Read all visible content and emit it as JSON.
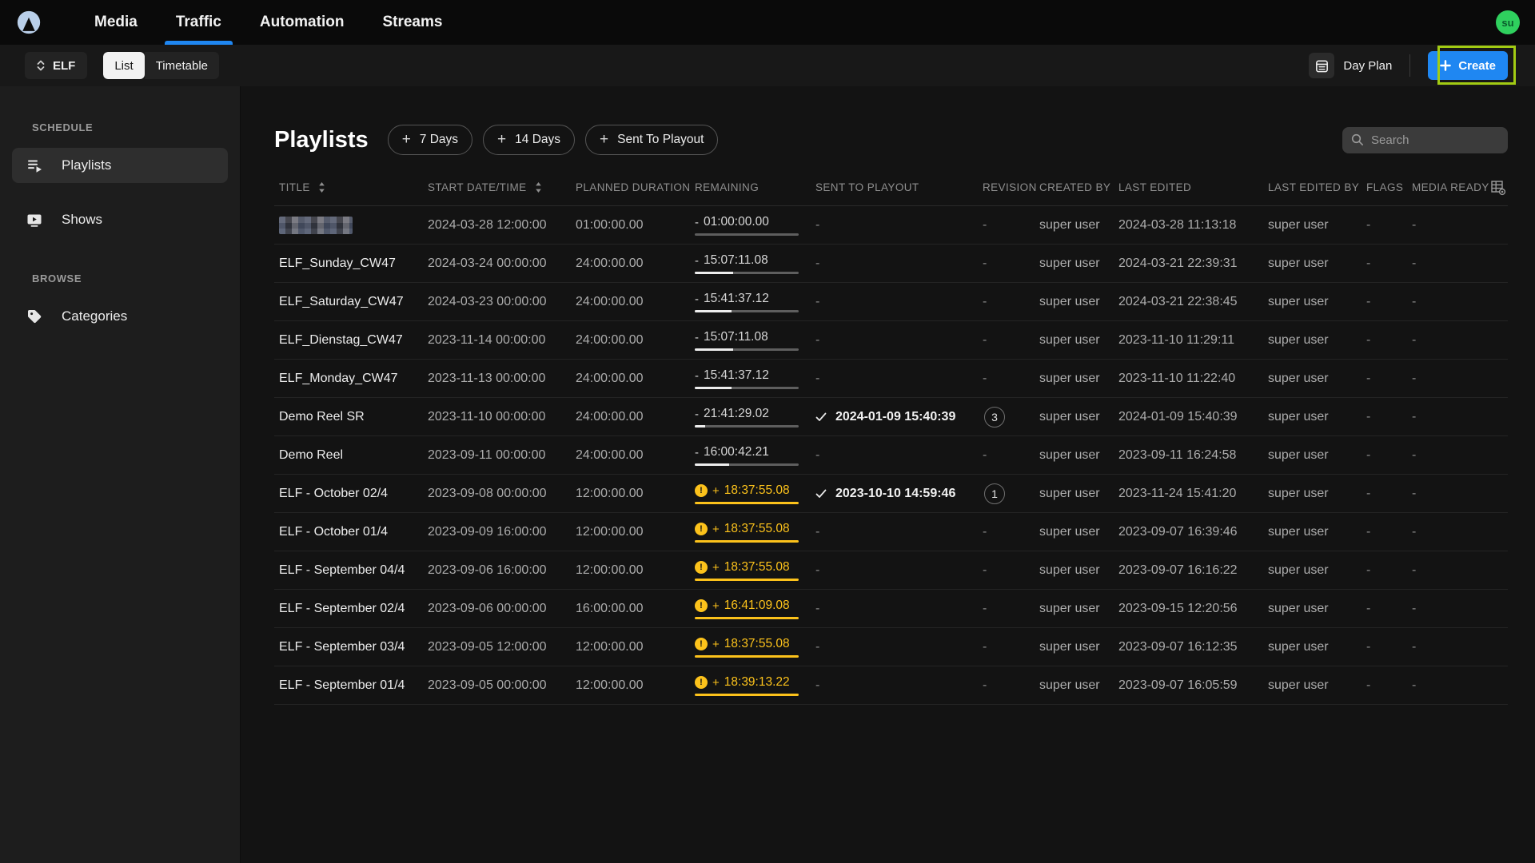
{
  "nav": {
    "items": [
      {
        "label": "Media",
        "active": false
      },
      {
        "label": "Traffic",
        "active": true
      },
      {
        "label": "Automation",
        "active": false
      },
      {
        "label": "Streams",
        "active": false
      }
    ],
    "avatar_initials": "su"
  },
  "toolbar": {
    "channel_selector_label": "ELF",
    "view_toggle": {
      "options": [
        "List",
        "Timetable"
      ],
      "active": "List"
    },
    "day_plan_label": "Day Plan",
    "create_label": "Create"
  },
  "sidebar": {
    "sections": [
      {
        "title": "SCHEDULE",
        "items": [
          {
            "label": "Playlists",
            "icon": "playlist-icon",
            "active": true
          },
          {
            "label": "Shows",
            "icon": "shows-icon",
            "active": false
          }
        ]
      },
      {
        "title": "BROWSE",
        "items": [
          {
            "label": "Categories",
            "icon": "categories-icon",
            "active": false
          }
        ]
      }
    ]
  },
  "content": {
    "title": "Playlists",
    "filter_chips": [
      {
        "label": "7 Days"
      },
      {
        "label": "14 Days"
      },
      {
        "label": "Sent To Playout"
      }
    ],
    "search_placeholder": "Search"
  },
  "table": {
    "columns": [
      {
        "label": "TITLE",
        "sortable": true
      },
      {
        "label": "START DATE/TIME",
        "sortable": true
      },
      {
        "label": "PLANNED DURATION",
        "sortable": false
      },
      {
        "label": "REMAINING",
        "sortable": false
      },
      {
        "label": "SENT TO PLAYOUT",
        "sortable": false
      },
      {
        "label": "REVISION",
        "sortable": false
      },
      {
        "label": "CREATED BY",
        "sortable": false
      },
      {
        "label": "LAST EDITED",
        "sortable": false
      },
      {
        "label": "LAST EDITED BY",
        "sortable": false
      },
      {
        "label": "FLAGS",
        "sortable": false
      },
      {
        "label": "MEDIA READY",
        "sortable": false
      }
    ],
    "rows": [
      {
        "title": "",
        "censored": true,
        "start": "2024-03-28 12:00:00",
        "duration": "01:00:00.00",
        "remaining": {
          "sign": "-",
          "value": "01:00:00.00",
          "state": "normal",
          "progress": 0
        },
        "sent": null,
        "revision": null,
        "created_by": "super user",
        "last_edited": "2024-03-28 11:13:18",
        "last_edited_by": "super user",
        "flags": "-",
        "media_ready": "-"
      },
      {
        "title": "ELF_Sunday_CW47",
        "censored": false,
        "start": "2024-03-24 00:00:00",
        "duration": "24:00:00.00",
        "remaining": {
          "sign": "-",
          "value": "15:07:11.08",
          "state": "normal",
          "progress": 0.37
        },
        "sent": null,
        "revision": null,
        "created_by": "super user",
        "last_edited": "2024-03-21 22:39:31",
        "last_edited_by": "super user",
        "flags": "-",
        "media_ready": "-"
      },
      {
        "title": "ELF_Saturday_CW47",
        "censored": false,
        "start": "2024-03-23 00:00:00",
        "duration": "24:00:00.00",
        "remaining": {
          "sign": "-",
          "value": "15:41:37.12",
          "state": "normal",
          "progress": 0.35
        },
        "sent": null,
        "revision": null,
        "created_by": "super user",
        "last_edited": "2024-03-21 22:38:45",
        "last_edited_by": "super user",
        "flags": "-",
        "media_ready": "-"
      },
      {
        "title": "ELF_Dienstag_CW47",
        "censored": false,
        "start": "2023-11-14 00:00:00",
        "duration": "24:00:00.00",
        "remaining": {
          "sign": "-",
          "value": "15:07:11.08",
          "state": "normal",
          "progress": 0.37
        },
        "sent": null,
        "revision": null,
        "created_by": "super user",
        "last_edited": "2023-11-10 11:29:11",
        "last_edited_by": "super user",
        "flags": "-",
        "media_ready": "-"
      },
      {
        "title": "ELF_Monday_CW47",
        "censored": false,
        "start": "2023-11-13 00:00:00",
        "duration": "24:00:00.00",
        "remaining": {
          "sign": "-",
          "value": "15:41:37.12",
          "state": "normal",
          "progress": 0.35
        },
        "sent": null,
        "revision": null,
        "created_by": "super user",
        "last_edited": "2023-11-10 11:22:40",
        "last_edited_by": "super user",
        "flags": "-",
        "media_ready": "-"
      },
      {
        "title": "Demo Reel SR",
        "censored": false,
        "start": "2023-11-10 00:00:00",
        "duration": "24:00:00.00",
        "remaining": {
          "sign": "-",
          "value": "21:41:29.02",
          "state": "normal",
          "progress": 0.1
        },
        "sent": "2024-01-09 15:40:39",
        "revision": "3",
        "created_by": "super user",
        "last_edited": "2024-01-09 15:40:39",
        "last_edited_by": "super user",
        "flags": "-",
        "media_ready": "-"
      },
      {
        "title": "Demo Reel",
        "censored": false,
        "start": "2023-09-11 00:00:00",
        "duration": "24:00:00.00",
        "remaining": {
          "sign": "-",
          "value": "16:00:42.21",
          "state": "normal",
          "progress": 0.33
        },
        "sent": null,
        "revision": null,
        "created_by": "super user",
        "last_edited": "2023-09-11 16:24:58",
        "last_edited_by": "super user",
        "flags": "-",
        "media_ready": "-"
      },
      {
        "title": "ELF - October 02/4",
        "censored": false,
        "start": "2023-09-08 00:00:00",
        "duration": "12:00:00.00",
        "remaining": {
          "sign": "+",
          "value": "18:37:55.08",
          "state": "overrun",
          "progress": 1
        },
        "sent": "2023-10-10 14:59:46",
        "revision": "1",
        "created_by": "super user",
        "last_edited": "2023-11-24 15:41:20",
        "last_edited_by": "super user",
        "flags": "-",
        "media_ready": "-"
      },
      {
        "title": "ELF - October 01/4",
        "censored": false,
        "start": "2023-09-09 16:00:00",
        "duration": "12:00:00.00",
        "remaining": {
          "sign": "+",
          "value": "18:37:55.08",
          "state": "overrun",
          "progress": 1
        },
        "sent": null,
        "revision": null,
        "created_by": "super user",
        "last_edited": "2023-09-07 16:39:46",
        "last_edited_by": "super user",
        "flags": "-",
        "media_ready": "-"
      },
      {
        "title": "ELF - September 04/4",
        "censored": false,
        "start": "2023-09-06 16:00:00",
        "duration": "12:00:00.00",
        "remaining": {
          "sign": "+",
          "value": "18:37:55.08",
          "state": "overrun",
          "progress": 1
        },
        "sent": null,
        "revision": null,
        "created_by": "super user",
        "last_edited": "2023-09-07 16:16:22",
        "last_edited_by": "super user",
        "flags": "-",
        "media_ready": "-"
      },
      {
        "title": "ELF - September 02/4",
        "censored": false,
        "start": "2023-09-06 00:00:00",
        "duration": "16:00:00.00",
        "remaining": {
          "sign": "+",
          "value": "16:41:09.08",
          "state": "overrun",
          "progress": 1
        },
        "sent": null,
        "revision": null,
        "created_by": "super user",
        "last_edited": "2023-09-15 12:20:56",
        "last_edited_by": "super user",
        "flags": "-",
        "media_ready": "-"
      },
      {
        "title": "ELF - September 03/4",
        "censored": false,
        "start": "2023-09-05 12:00:00",
        "duration": "12:00:00.00",
        "remaining": {
          "sign": "+",
          "value": "18:37:55.08",
          "state": "overrun",
          "progress": 1
        },
        "sent": null,
        "revision": null,
        "created_by": "super user",
        "last_edited": "2023-09-07 16:12:35",
        "last_edited_by": "super user",
        "flags": "-",
        "media_ready": "-"
      },
      {
        "title": "ELF - September 01/4",
        "censored": false,
        "start": "2023-09-05 00:00:00",
        "duration": "12:00:00.00",
        "remaining": {
          "sign": "+",
          "value": "18:39:13.22",
          "state": "overrun",
          "progress": 1
        },
        "sent": null,
        "revision": null,
        "created_by": "super user",
        "last_edited": "2023-09-07 16:05:59",
        "last_edited_by": "super user",
        "flags": "-",
        "media_ready": "-"
      }
    ]
  },
  "colors": {
    "accent_blue": "#1f87f2",
    "warning_yellow": "#fcc21b",
    "avatar_green": "#2fd05e",
    "highlight_green": "#a2cb13"
  }
}
